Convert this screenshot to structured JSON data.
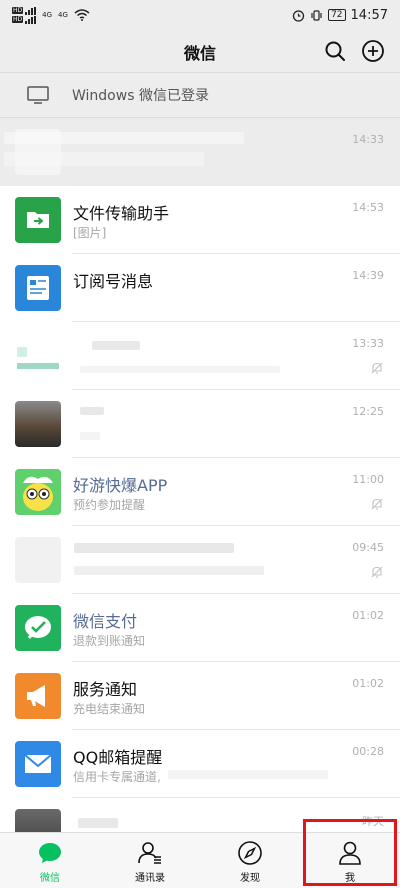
{
  "status_bar": {
    "sim1": "HD",
    "sim2": "HD",
    "net1": "4G",
    "net2": "4G",
    "battery": "72",
    "time": "14:57"
  },
  "header": {
    "title": "微信",
    "search_icon": "search-icon",
    "add_icon": "plus-circle-icon"
  },
  "login_banner": {
    "icon": "monitor-icon",
    "text": "Windows 微信已登录"
  },
  "chats": [
    {
      "name": "",
      "preview": "",
      "time": "14:33",
      "avatar": "blurred",
      "muted": false,
      "pinned": true
    },
    {
      "name": "文件传输助手",
      "preview": "[图片]",
      "time": "14:53",
      "avatar": "file-transfer",
      "muted": false
    },
    {
      "name": "订阅号消息",
      "preview": "",
      "time": "14:39",
      "avatar": "subscription",
      "muted": false
    },
    {
      "name": "",
      "preview": "",
      "time": "13:33",
      "avatar": "blurred",
      "muted": true
    },
    {
      "name": "",
      "preview": "",
      "time": "12:25",
      "avatar": "photo",
      "muted": false
    },
    {
      "name": "好游快爆APP",
      "preview": "预约参加提醒",
      "time": "11:00",
      "avatar": "cartoon",
      "muted": true,
      "official": true
    },
    {
      "name": "",
      "preview": "",
      "time": "09:45",
      "avatar": "blurred",
      "muted": true
    },
    {
      "name": "微信支付",
      "preview": "退款到账通知",
      "time": "01:02",
      "avatar": "wechat-pay",
      "muted": false,
      "official": true
    },
    {
      "name": "服务通知",
      "preview": "充电结束通知",
      "time": "01:02",
      "avatar": "service",
      "muted": false
    },
    {
      "name": "QQ邮箱提醒",
      "preview": "信用卡专属通道,",
      "time": "00:28",
      "avatar": "mail",
      "muted": false
    },
    {
      "name": "",
      "preview": "",
      "time": "昨天",
      "avatar": "photo",
      "muted": false
    }
  ],
  "tabs": [
    {
      "label": "微信",
      "icon": "chat-bubble-icon",
      "active": true
    },
    {
      "label": "通讯录",
      "icon": "contacts-icon",
      "active": false
    },
    {
      "label": "发现",
      "icon": "compass-icon",
      "active": false
    },
    {
      "label": "我",
      "icon": "person-icon",
      "active": false
    }
  ],
  "colors": {
    "accent": "#07c160",
    "highlight": "#e0161d",
    "official_name": "#576b95"
  }
}
